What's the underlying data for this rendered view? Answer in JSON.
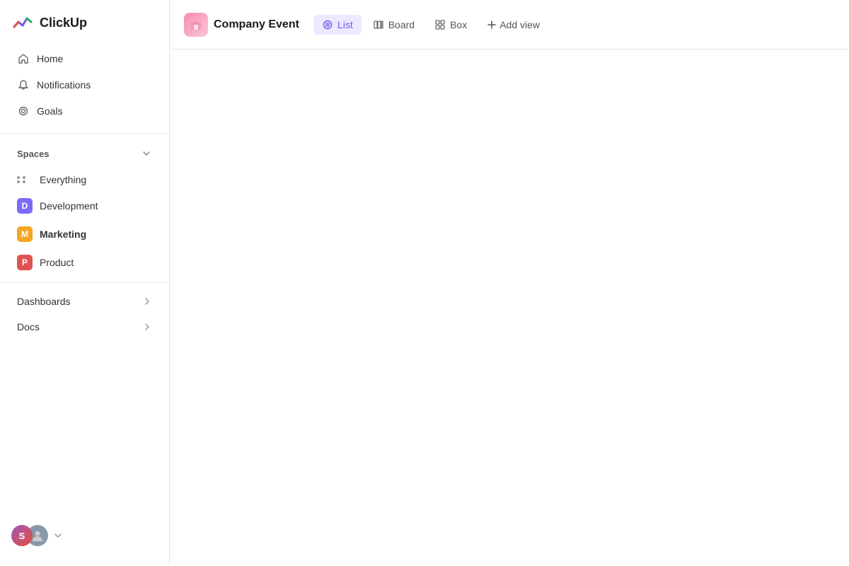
{
  "app": {
    "name": "ClickUp"
  },
  "sidebar": {
    "nav": [
      {
        "id": "home",
        "label": "Home",
        "icon": "home-icon"
      },
      {
        "id": "notifications",
        "label": "Notifications",
        "icon": "bell-icon"
      },
      {
        "id": "goals",
        "label": "Goals",
        "icon": "goals-icon"
      }
    ],
    "spaces_label": "Spaces",
    "spaces": [
      {
        "id": "everything",
        "label": "Everything",
        "type": "dots"
      },
      {
        "id": "development",
        "label": "Development",
        "type": "avatar",
        "letter": "D",
        "color": "avatar-d"
      },
      {
        "id": "marketing",
        "label": "Marketing",
        "type": "avatar",
        "letter": "M",
        "color": "avatar-m",
        "bold": true
      },
      {
        "id": "product",
        "label": "Product",
        "type": "avatar",
        "letter": "P",
        "color": "avatar-p"
      }
    ],
    "sections": [
      {
        "id": "dashboards",
        "label": "Dashboards"
      },
      {
        "id": "docs",
        "label": "Docs"
      }
    ]
  },
  "topbar": {
    "project_name": "Company Event",
    "views": [
      {
        "id": "list",
        "label": "List",
        "icon": "list-icon",
        "active": true
      },
      {
        "id": "board",
        "label": "Board",
        "icon": "board-icon",
        "active": false
      },
      {
        "id": "box",
        "label": "Box",
        "icon": "box-icon",
        "active": false
      }
    ],
    "add_view_label": "Add view"
  }
}
